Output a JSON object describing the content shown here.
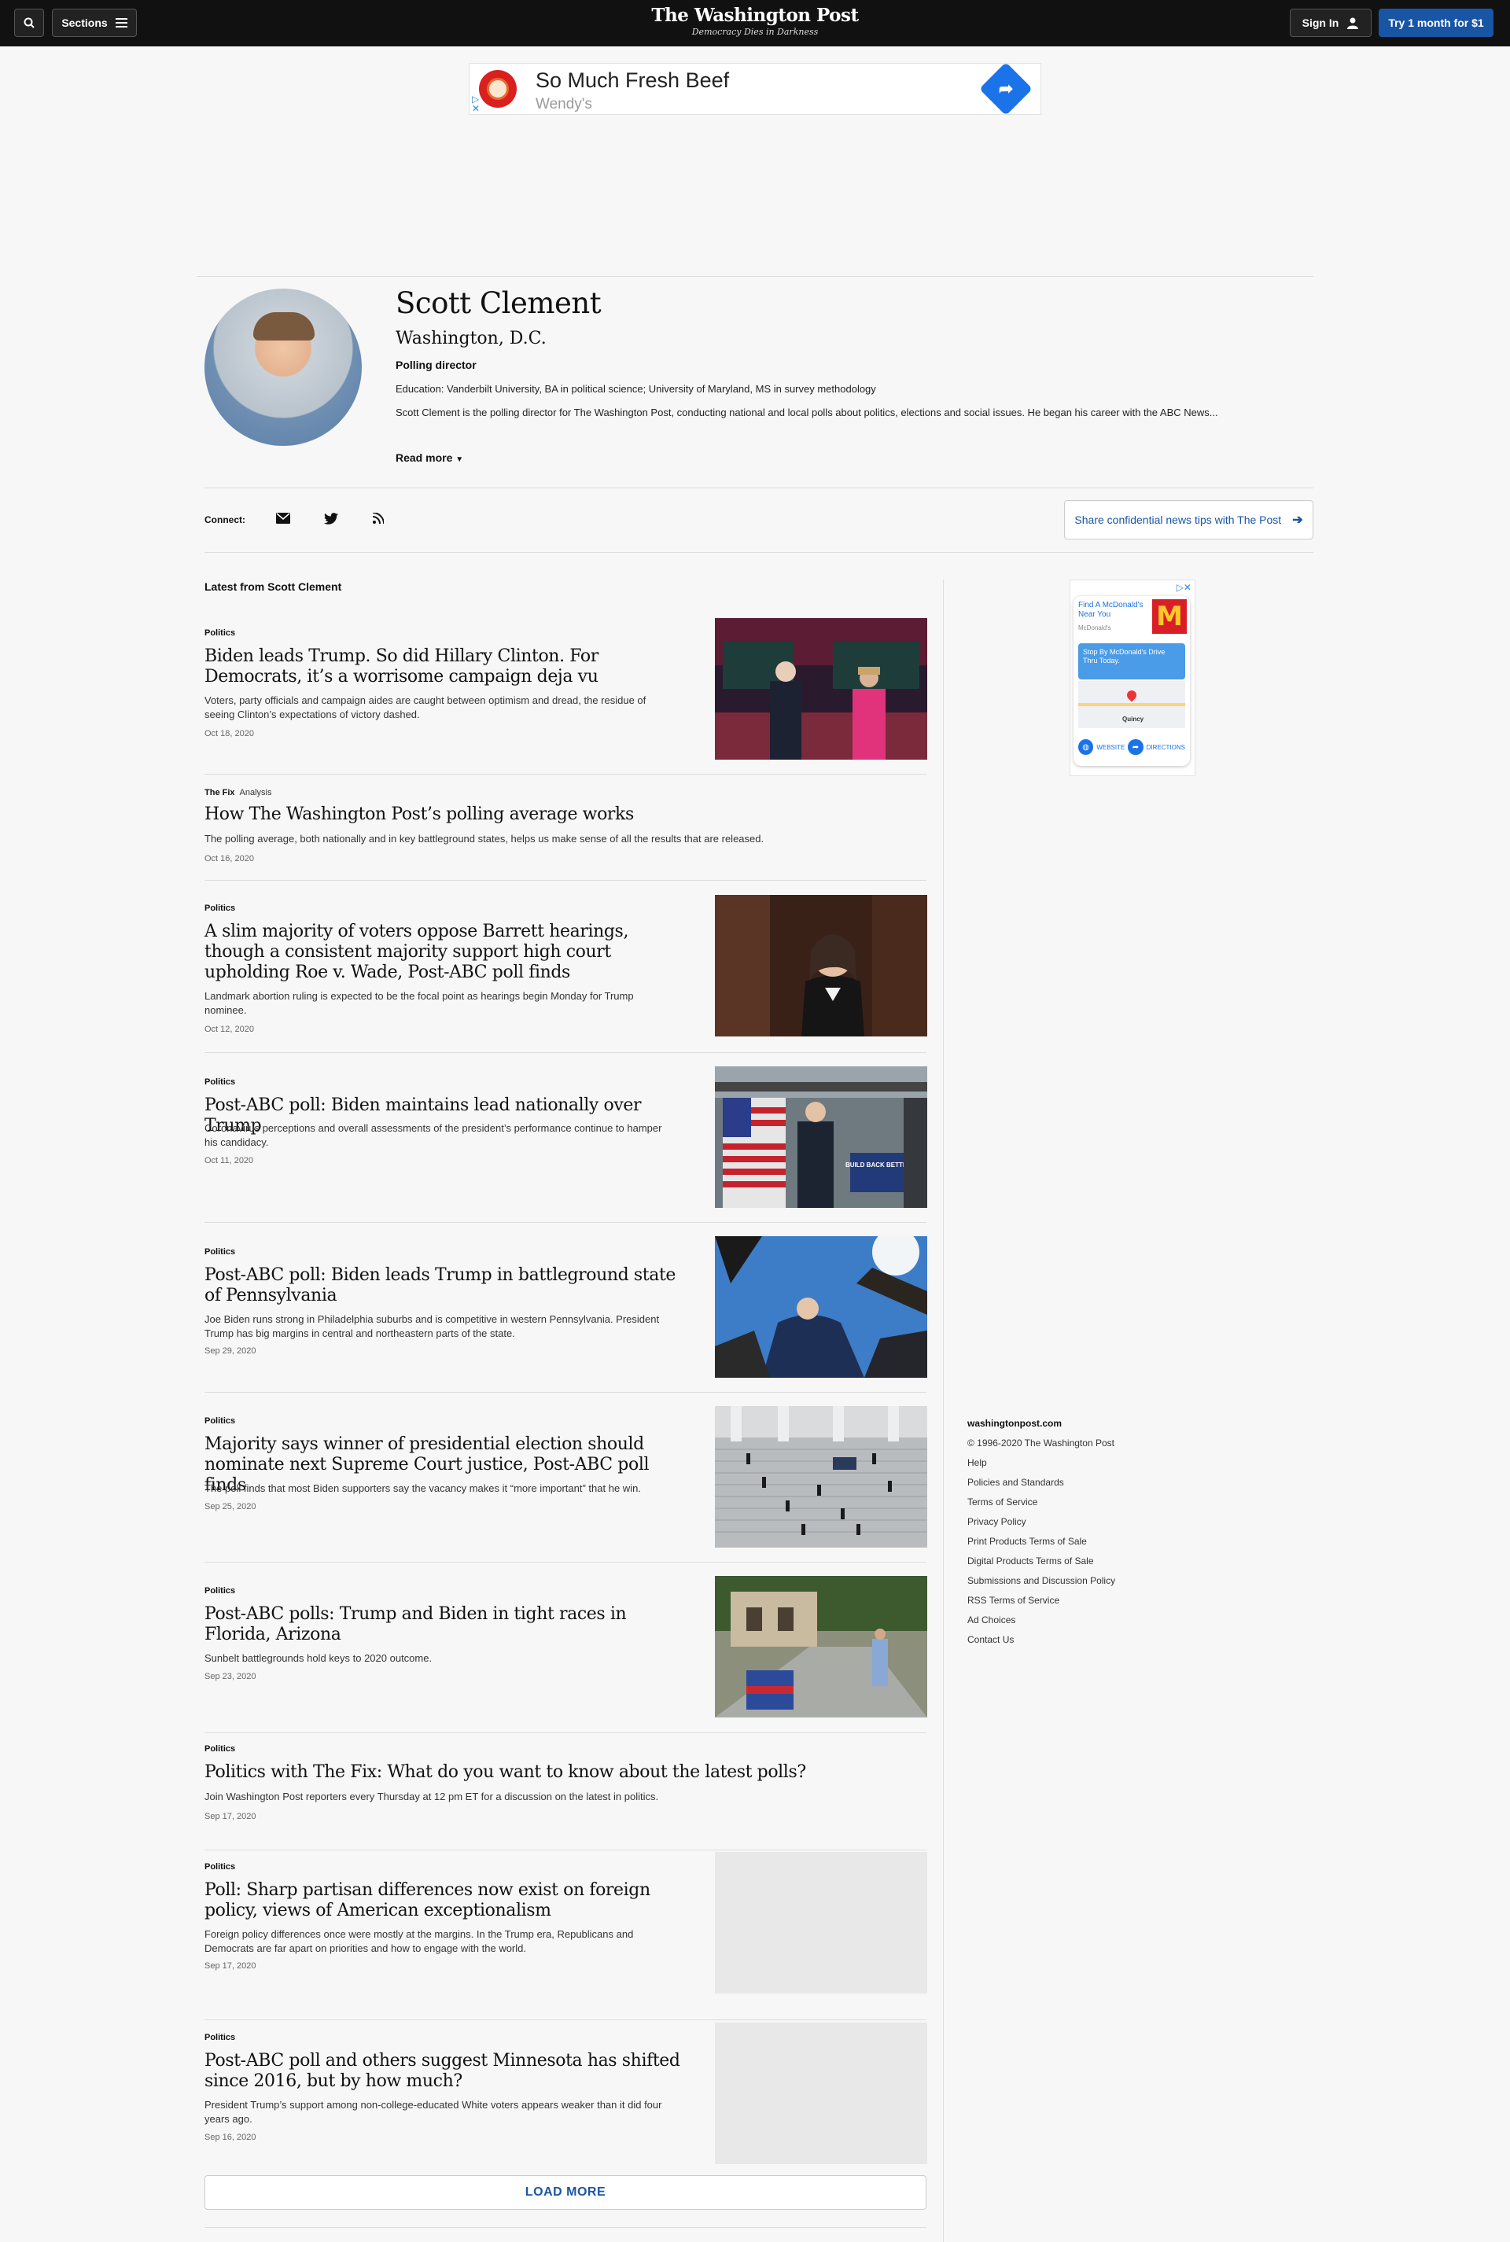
{
  "nav": {
    "sections_label": "Sections",
    "logo_title": "The Washington Post",
    "logo_tagline": "Democracy Dies in Darkness",
    "signin_label": "Sign In",
    "subscribe_label": "Try 1 month for $1"
  },
  "top_ad": {
    "headline": "So Much Fresh Beef",
    "advertiser": "Wendy's"
  },
  "author": {
    "name": "Scott Clement",
    "location": "Washington, D.C.",
    "title": "Polling director",
    "education": "Education: Vanderbilt University, BA in political science; University of Maryland, MS in survey methodology",
    "bio": "Scott Clement is the polling director for The Washington Post, conducting national and local polls about politics, elections and social issues. He began his career with the ABC News...",
    "read_more": "Read more"
  },
  "connect": {
    "label": "Connect:",
    "tips_label": "Share confidential news tips with The Post"
  },
  "latest_heading": "Latest from Scott Clement",
  "articles": [
    {
      "kicker": "Politics",
      "title": "Biden leads Trump. So did Hillary Clinton. For Democrats, it’s a worrisome campaign deja vu",
      "blurb": "Voters, party officials and campaign aides are caught between optimism and dread, the residue of seeing Clinton’s expectations of victory dashed.",
      "date": "Oct 18, 2020"
    },
    {
      "kicker": "The Fix",
      "kicker_extra": "Analysis",
      "title": "How The Washington Post’s polling average works",
      "blurb": "The polling average, both nationally and in key battleground states, helps us make sense of all the results that are released.",
      "date": "Oct 16, 2020"
    },
    {
      "kicker": "Politics",
      "title": "A slim majority of voters oppose Barrett hearings, though a consistent majority support high court upholding Roe v. Wade, Post-ABC poll finds",
      "blurb": "Landmark abortion ruling is expected to be the focal point as hearings begin Monday for Trump nominee.",
      "date": "Oct 12, 2020"
    },
    {
      "kicker": "Politics",
      "title": "Post-ABC poll: Biden maintains lead nationally over Trump",
      "blurb": "Coronavirus perceptions and overall assessments of the president’s performance continue to hamper his candidacy.",
      "date": "Oct 11, 2020",
      "image_sign": "BUILD BACK BETTER"
    },
    {
      "kicker": "Politics",
      "title": "Post-ABC poll: Biden leads Trump in battleground state of Pennsylvania",
      "blurb": "Joe Biden runs strong in Philadelphia suburbs and is competitive in western Pennsylvania. President Trump has big margins in central and northeastern parts of the state.",
      "date": "Sep 29, 2020"
    },
    {
      "kicker": "Politics",
      "title": "Majority says winner of presidential election should nominate next Supreme Court justice, Post-ABC poll finds",
      "blurb": "The poll finds that most Biden supporters say the vacancy makes it “more important” that he win.",
      "date": "Sep 25, 2020"
    },
    {
      "kicker": "Politics",
      "title": "Post-ABC polls: Trump and Biden in tight races in Florida, Arizona",
      "blurb": "Sunbelt battlegrounds hold keys to 2020 outcome.",
      "date": "Sep 23, 2020"
    },
    {
      "kicker": "Politics",
      "title": "Politics with The Fix: What do you want to know about the latest polls?",
      "blurb": "Join Washington Post reporters every Thursday at 12 pm ET for a discussion on the latest in politics.",
      "date": "Sep 17, 2020"
    },
    {
      "kicker": "Politics",
      "title": "Poll: Sharp partisan differences now exist on foreign policy, views of American exceptionalism",
      "blurb": "Foreign policy differences once were mostly at the margins. In the Trump era, Republicans and Democrats are far apart on priorities and how to engage with the world.",
      "date": "Sep 17, 2020"
    },
    {
      "kicker": "Politics",
      "title": "Post-ABC poll and others suggest Minnesota has shifted since 2016, but by how much?",
      "blurb": "President Trump’s support among non-college-educated White voters appears weaker than it did four years ago.",
      "date": "Sep 16, 2020"
    }
  ],
  "load_more": "LOAD MORE",
  "side_ad": {
    "title": "Find A McDonald's Near You",
    "advertiser": "McDonald's",
    "promo": "Stop By McDonald's Drive Thru Today.",
    "map_label": "Quincy",
    "website_label": "WEBSITE",
    "directions_label": "DIRECTIONS"
  },
  "footer": {
    "domain": "washingtonpost.com",
    "copyright": "© 1996-2020 The Washington Post",
    "links": [
      "Help",
      "Policies and Standards",
      "Terms of Service",
      "Privacy Policy",
      "Print Products Terms of Sale",
      "Digital Products Terms of Sale",
      "Submissions and Discussion Policy",
      "RSS Terms of Service",
      "Ad Choices",
      "Contact Us"
    ]
  }
}
